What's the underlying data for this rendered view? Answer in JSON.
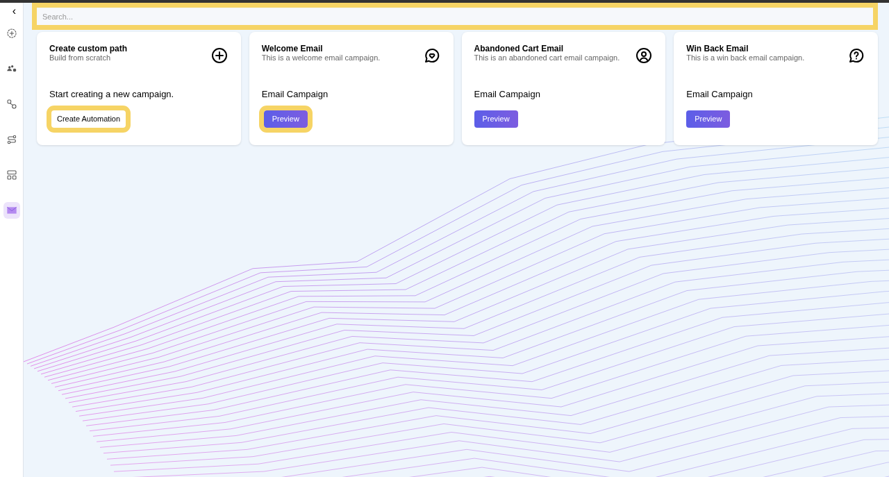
{
  "sidebar": {
    "collapse_icon": "‹",
    "items": [
      {
        "selected": false
      },
      {
        "selected": false
      },
      {
        "selected": false
      },
      {
        "selected": false
      },
      {
        "selected": false
      },
      {
        "selected": true
      }
    ]
  },
  "search": {
    "placeholder": "Search...",
    "highlighted": true
  },
  "cards": [
    {
      "kind": "custom",
      "title": "Create custom path",
      "subtitle": "Build from scratch",
      "body": "Start creating a new campaign.",
      "button": "Create Automation",
      "highlighted": true
    },
    {
      "kind": "template",
      "title": "Welcome Email",
      "subtitle": "This is a welcome email campaign.",
      "body": "Email Campaign",
      "button": "Preview",
      "highlighted": true
    },
    {
      "kind": "template",
      "title": "Abandoned Cart Email",
      "subtitle": "This is an abandoned cart email campaign.",
      "body": "Email Campaign",
      "button": "Preview",
      "highlighted": false
    },
    {
      "kind": "template",
      "title": "Win Back Email",
      "subtitle": "This is a win back email campaign.",
      "body": "Email Campaign",
      "button": "Preview",
      "highlighted": false
    }
  ]
}
